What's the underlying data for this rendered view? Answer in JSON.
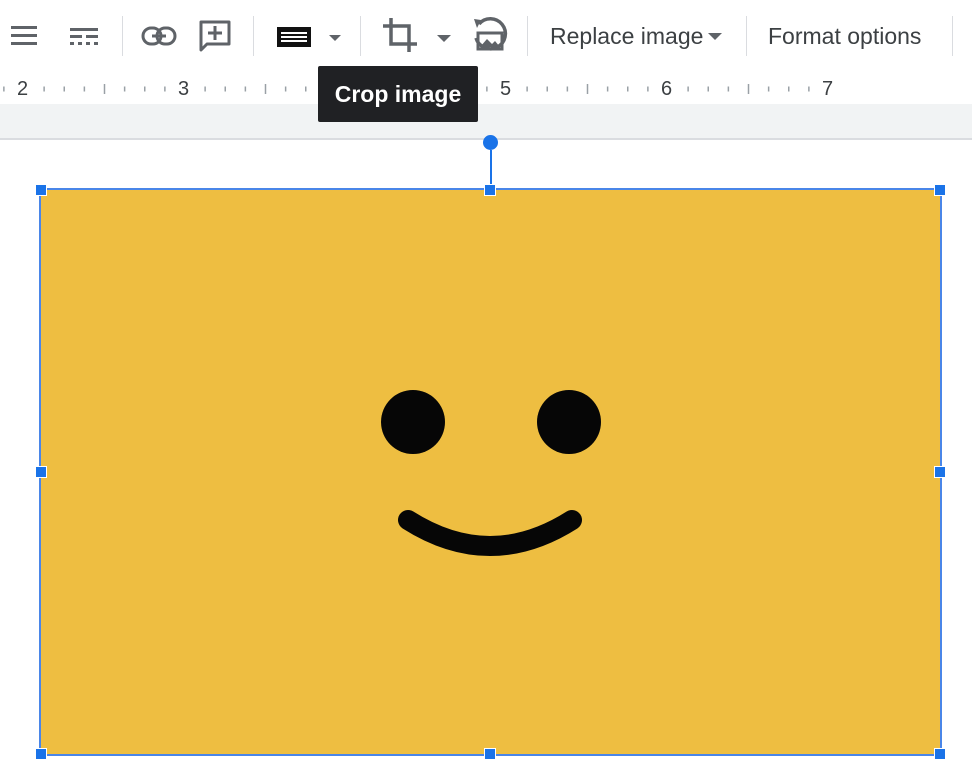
{
  "toolbar": {
    "replace_image_label": "Replace image",
    "format_options_label": "Format options"
  },
  "tooltip": {
    "text": "Crop image"
  },
  "ruler": {
    "numbers": [
      "2",
      "3",
      "5",
      "6",
      "7"
    ]
  },
  "image": {
    "background_color": "#eebe41",
    "face_color": "#060606"
  },
  "colors": {
    "selection_accent": "#1a73e8",
    "toolbar_icon": "#5f6368"
  },
  "icons": [
    "align-icon",
    "line-spacing-icon",
    "link-icon",
    "add-comment-icon",
    "border-color-icon",
    "crop-icon",
    "reset-image-icon"
  ]
}
